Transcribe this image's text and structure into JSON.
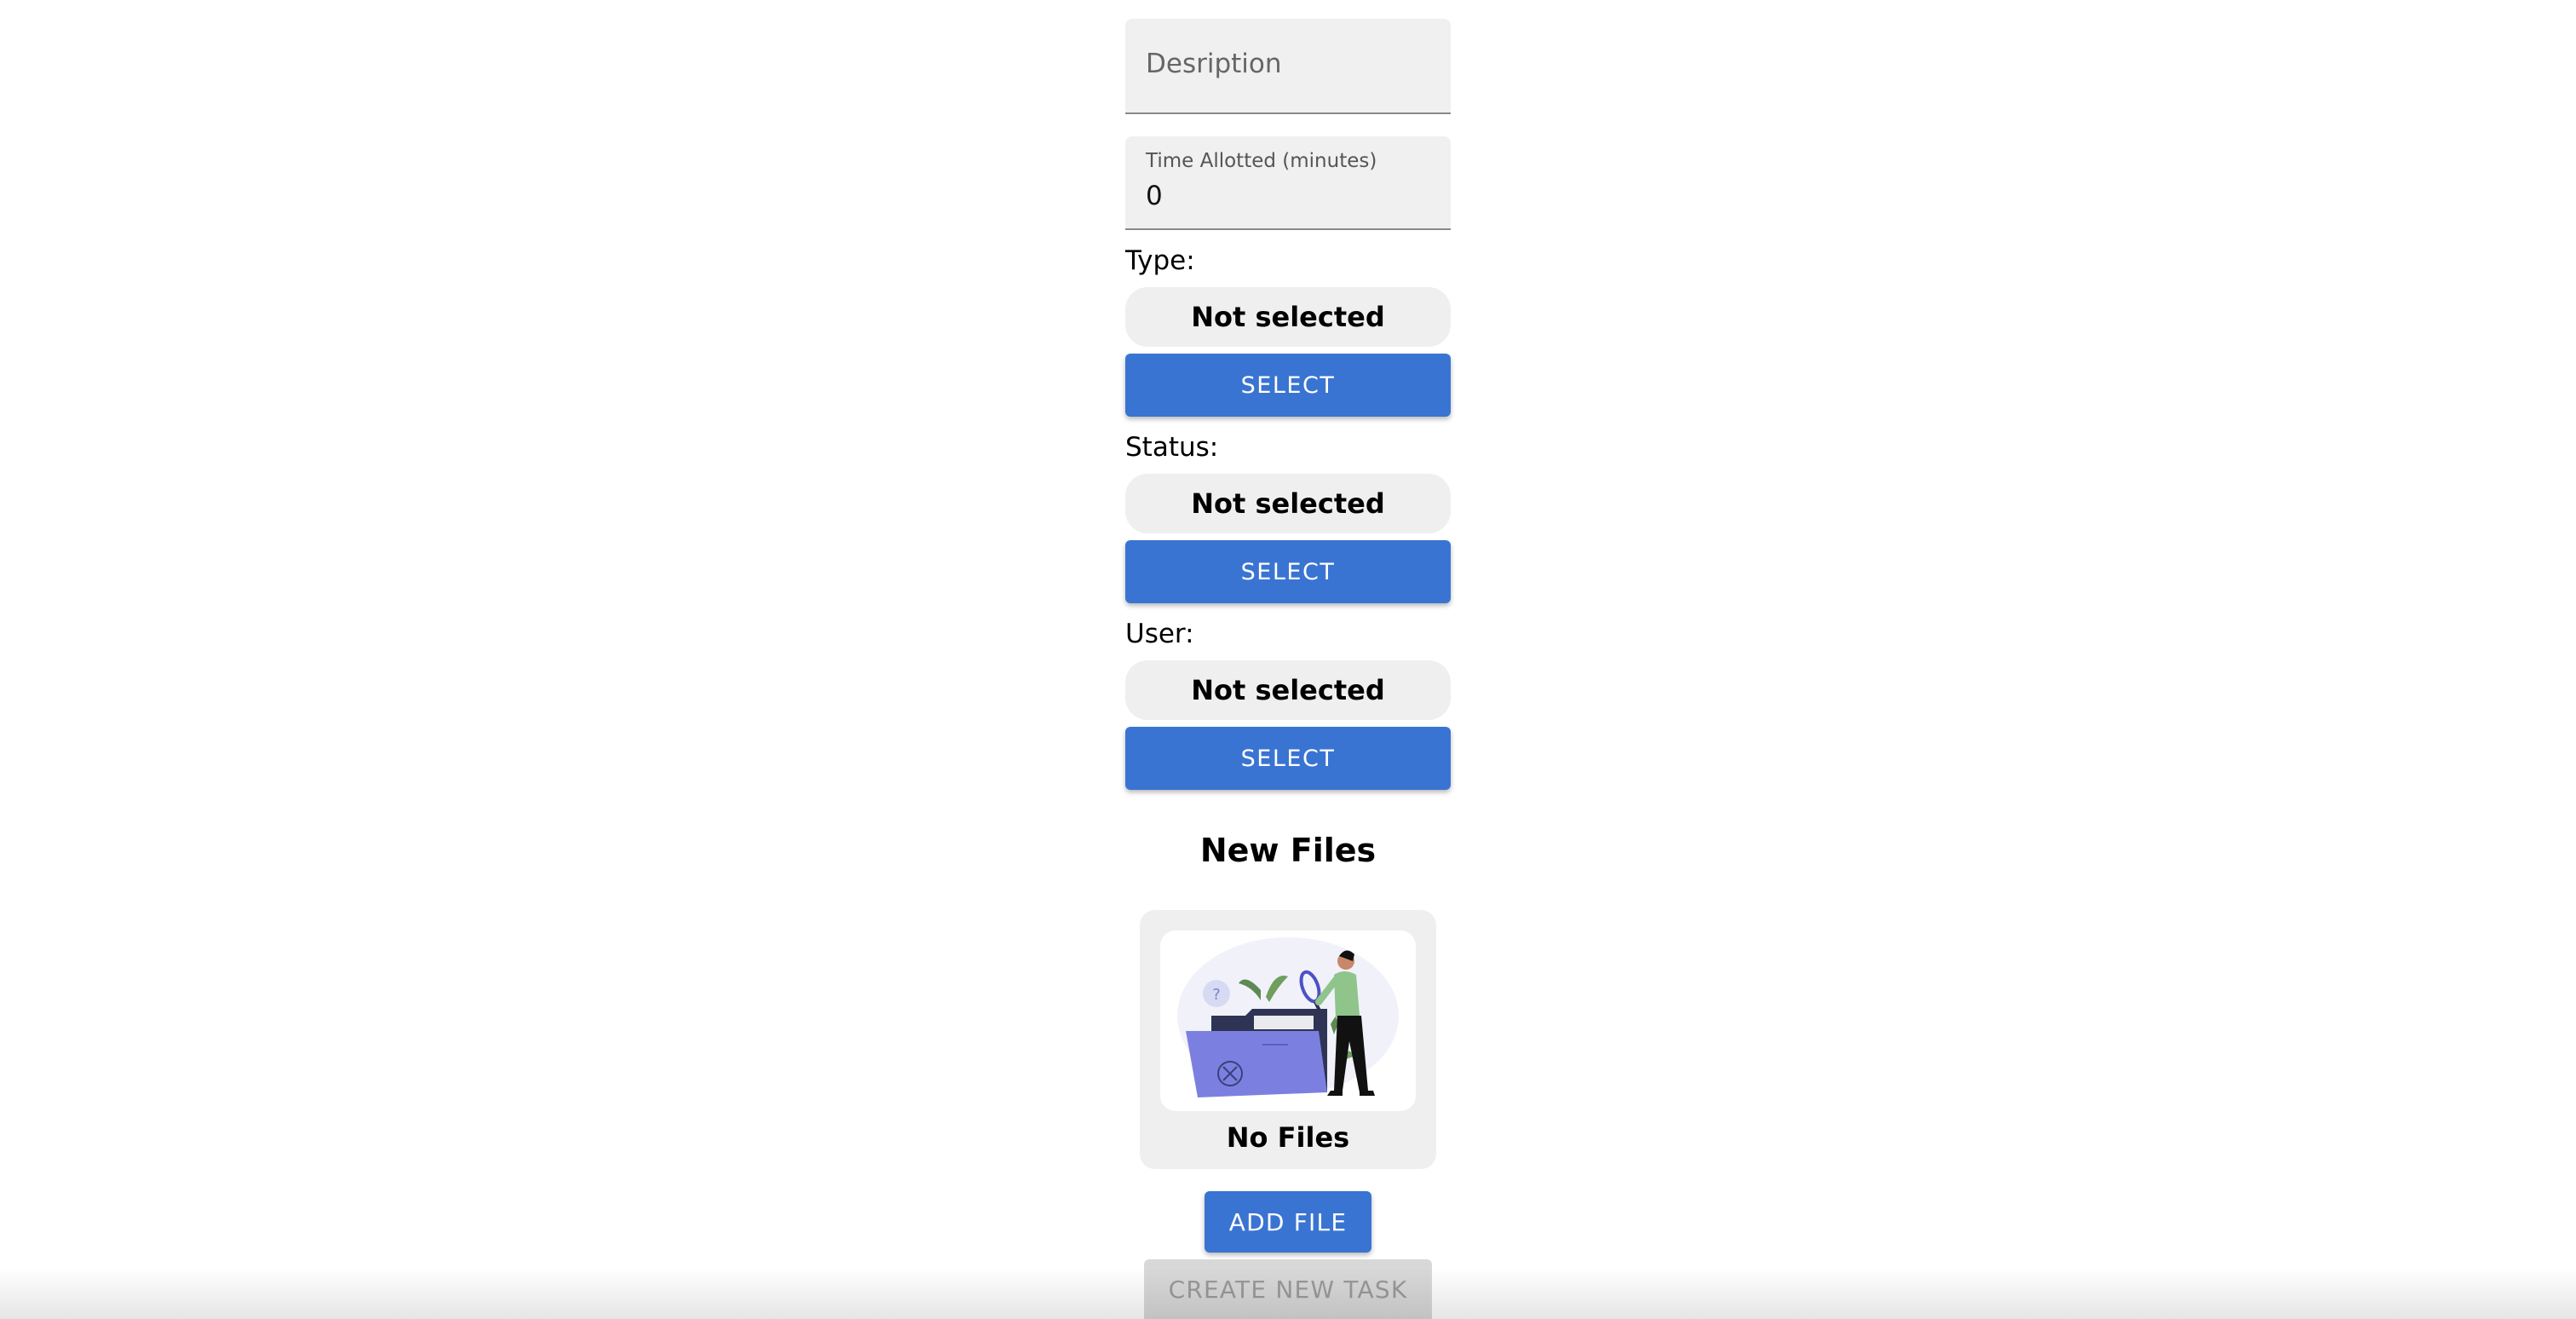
{
  "form": {
    "description": {
      "placeholder": "Desription",
      "value": ""
    },
    "time_allotted": {
      "label": "Time Allotted (minutes)",
      "value": "0"
    },
    "type": {
      "label": "Type:",
      "selected": "Not selected",
      "button_label": "SELECT"
    },
    "status": {
      "label": "Status:",
      "selected": "Not selected",
      "button_label": "SELECT"
    },
    "user": {
      "label": "User:",
      "selected": "Not selected",
      "button_label": "SELECT"
    }
  },
  "files": {
    "section_title": "New Files",
    "empty_text": "No Files",
    "illustration_icon": "empty-folder-search-illustration",
    "add_button_label": "ADD FILE"
  },
  "actions": {
    "create_label": "CREATE NEW TASK"
  },
  "colors": {
    "primary": "#3a74d2",
    "field_bg": "#f0f0f0",
    "disabled_bg": "#d8d8d8",
    "disabled_text": "#9a9a9a"
  }
}
